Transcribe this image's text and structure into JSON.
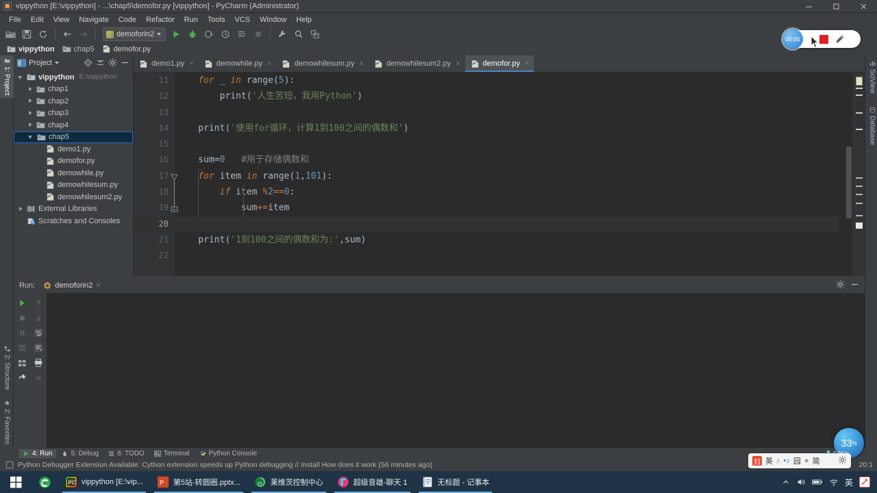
{
  "window": {
    "title": "vippython [E:\\vippython] - ...\\chap5\\demofor.py [vippython] - PyCharm (Administrator)",
    "app_icon": "pycharm-icon",
    "minimize": "–",
    "maximize": "□",
    "close": "✕"
  },
  "menubar": {
    "items": [
      {
        "label": "File"
      },
      {
        "label": "Edit"
      },
      {
        "label": "View"
      },
      {
        "label": "Navigate"
      },
      {
        "label": "Code"
      },
      {
        "label": "Refactor"
      },
      {
        "label": "Run"
      },
      {
        "label": "Tools"
      },
      {
        "label": "VCS"
      },
      {
        "label": "Window"
      },
      {
        "label": "Help"
      }
    ]
  },
  "toolbar": {
    "open_icon": "open-folder-icon",
    "save_icon": "save-icon",
    "sync_icon": "sync-icon",
    "back_icon": "arrow-back-icon",
    "forward_icon": "arrow-forward-icon",
    "run_config_name": "demoforin2",
    "run_icon": "run-icon",
    "debug_icon": "debug-icon",
    "coverage_icon": "run-coverage-icon",
    "profile_icon": "profile-icon",
    "rerun_icon": "run-with-console-icon",
    "stop_icon": "stop-icon",
    "settings_icon": "wrench-icon",
    "search_icon": "search-icon",
    "vcs_icon": "vcs-update-icon"
  },
  "breadcrumb": {
    "items": [
      {
        "label": "vippython",
        "icon": "folder-icon"
      },
      {
        "label": "chap5",
        "icon": "folder-icon"
      },
      {
        "label": "demofor.py",
        "icon": "python-file-icon"
      }
    ]
  },
  "left_stripe": {
    "items": [
      {
        "label": "1: Project",
        "icon": "project-icon",
        "selected": true
      },
      {
        "label": "2: Structure",
        "icon": "structure-icon",
        "selected": false
      },
      {
        "label": "2: Favorites",
        "icon": "star-icon",
        "selected": false
      }
    ]
  },
  "right_stripe": {
    "items": [
      {
        "label": "SciView",
        "icon": "sciview-icon"
      },
      {
        "label": "Database",
        "icon": "database-icon"
      }
    ]
  },
  "project_panel": {
    "title": "Project",
    "dropdown_icon": "chevron-down-icon",
    "actions": [
      {
        "name": "locate-icon"
      },
      {
        "name": "collapse-all-icon"
      },
      {
        "name": "gear-icon"
      },
      {
        "name": "hide-icon"
      }
    ],
    "tree": [
      {
        "label": "vippython",
        "path": "E:\\vippython",
        "depth": 0,
        "arrow": "open",
        "icon": "folder-icon",
        "bold": true,
        "selected": false
      },
      {
        "label": "chap1",
        "path": "",
        "depth": 1,
        "arrow": "closed",
        "icon": "folder-icon",
        "bold": false,
        "selected": false
      },
      {
        "label": "chap2",
        "path": "",
        "depth": 1,
        "arrow": "closed",
        "icon": "folder-icon",
        "bold": false,
        "selected": false
      },
      {
        "label": "chap3",
        "path": "",
        "depth": 1,
        "arrow": "closed",
        "icon": "folder-icon",
        "bold": false,
        "selected": false
      },
      {
        "label": "chap4",
        "path": "",
        "depth": 1,
        "arrow": "closed",
        "icon": "folder-icon",
        "bold": false,
        "selected": false
      },
      {
        "label": "chap5",
        "path": "",
        "depth": 1,
        "arrow": "open",
        "icon": "folder-icon",
        "bold": false,
        "selected": true
      },
      {
        "label": "demo1.py",
        "path": "",
        "depth": 2,
        "arrow": "none",
        "icon": "python-file-icon",
        "bold": false,
        "selected": false
      },
      {
        "label": "demofor.py",
        "path": "",
        "depth": 2,
        "arrow": "none",
        "icon": "python-file-icon",
        "bold": false,
        "selected": false
      },
      {
        "label": "demowhile.py",
        "path": "",
        "depth": 2,
        "arrow": "none",
        "icon": "python-file-icon",
        "bold": false,
        "selected": false
      },
      {
        "label": "demowhilesum.py",
        "path": "",
        "depth": 2,
        "arrow": "none",
        "icon": "python-file-icon",
        "bold": false,
        "selected": false
      },
      {
        "label": "demowhilesum2.py",
        "path": "",
        "depth": 2,
        "arrow": "none",
        "icon": "python-file-icon",
        "bold": false,
        "selected": false
      },
      {
        "label": "External Libraries",
        "path": "",
        "depth": 0,
        "arrow": "closed",
        "icon": "library-icon",
        "bold": false,
        "selected": false
      },
      {
        "label": "Scratches and Consoles",
        "path": "",
        "depth": 0,
        "arrow": "none",
        "icon": "scratches-icon",
        "bold": false,
        "selected": false
      }
    ]
  },
  "editor": {
    "tabs": [
      {
        "label": "demo1.py",
        "active": false,
        "close": "×"
      },
      {
        "label": "demowhile.py",
        "active": false,
        "close": "×"
      },
      {
        "label": "demowhilesum.py",
        "active": false,
        "close": "×"
      },
      {
        "label": "demowhilesum2.py",
        "active": false,
        "close": "×"
      },
      {
        "label": "demofor.py",
        "active": true,
        "close": "×"
      }
    ],
    "first_line_number": 11,
    "caret_line": 20,
    "lines": [
      {
        "n": 11,
        "tokens": [
          {
            "t": "    ",
            "c": "plain"
          },
          {
            "t": "for",
            "c": "kw"
          },
          {
            "t": " _ ",
            "c": "plain"
          },
          {
            "t": "in",
            "c": "kw"
          },
          {
            "t": " range",
            "c": "plain"
          },
          {
            "t": "(",
            "c": "op"
          },
          {
            "t": "5",
            "c": "num"
          },
          {
            "t": "):",
            "c": "op"
          }
        ]
      },
      {
        "n": 12,
        "tokens": [
          {
            "t": "        print",
            "c": "plain"
          },
          {
            "t": "(",
            "c": "op"
          },
          {
            "t": "'人生苦短，我用Python'",
            "c": "str"
          },
          {
            "t": ")",
            "c": "op"
          }
        ]
      },
      {
        "n": 13,
        "tokens": []
      },
      {
        "n": 14,
        "tokens": [
          {
            "t": "    print",
            "c": "plain"
          },
          {
            "t": "(",
            "c": "op"
          },
          {
            "t": "'使用for循环，计算1到100之间的偶数和'",
            "c": "str"
          },
          {
            "t": ")",
            "c": "op"
          }
        ]
      },
      {
        "n": 15,
        "tokens": []
      },
      {
        "n": 16,
        "tokens": [
          {
            "t": "    sum",
            "c": "plain"
          },
          {
            "t": "=",
            "c": "op"
          },
          {
            "t": "0",
            "c": "num"
          },
          {
            "t": "   ",
            "c": "plain"
          },
          {
            "t": "#用于存储偶数和",
            "c": "cmt"
          }
        ]
      },
      {
        "n": 17,
        "tokens": [
          {
            "t": "    ",
            "c": "plain"
          },
          {
            "t": "for",
            "c": "kw"
          },
          {
            "t": " item ",
            "c": "plain"
          },
          {
            "t": "in",
            "c": "kw"
          },
          {
            "t": " range",
            "c": "plain"
          },
          {
            "t": "(",
            "c": "op"
          },
          {
            "t": "1",
            "c": "num"
          },
          {
            "t": ",",
            "c": "op"
          },
          {
            "t": "101",
            "c": "num"
          },
          {
            "t": "):",
            "c": "op"
          }
        ]
      },
      {
        "n": 18,
        "tokens": [
          {
            "t": "        ",
            "c": "plain"
          },
          {
            "t": "if",
            "c": "kw"
          },
          {
            "t": " item ",
            "c": "plain"
          },
          {
            "t": "%",
            "c": "kw2"
          },
          {
            "t": "2",
            "c": "num"
          },
          {
            "t": "==",
            "c": "kw2"
          },
          {
            "t": "0",
            "c": "num"
          },
          {
            "t": ":",
            "c": "op"
          }
        ]
      },
      {
        "n": 19,
        "tokens": [
          {
            "t": "            sum",
            "c": "plain"
          },
          {
            "t": "+=",
            "c": "kw2"
          },
          {
            "t": "item",
            "c": "plain"
          }
        ]
      },
      {
        "n": 20,
        "tokens": []
      },
      {
        "n": 21,
        "tokens": [
          {
            "t": "    print",
            "c": "plain"
          },
          {
            "t": "(",
            "c": "op"
          },
          {
            "t": "'1到100之间的偶数和为:'",
            "c": "str"
          },
          {
            "t": ",",
            "c": "op"
          },
          {
            "t": "sum",
            "c": "plain"
          },
          {
            "t": ")",
            "c": "op"
          }
        ]
      },
      {
        "n": 22,
        "tokens": []
      }
    ]
  },
  "run_panel": {
    "label": "Run:",
    "tab_name": "demoforin2",
    "tab_close": "×",
    "gear_icon": "gear-icon",
    "hide_icon": "hide-icon",
    "console_output": "",
    "toolbar_icons": [
      "rerun-icon",
      "up-stacktrace-icon",
      "stop-icon",
      "down-stacktrace-icon",
      "pause-icon",
      "soft-wrap-icon",
      "print-to-file-icon",
      "scroll-to-end-icon",
      "clear-all-icon",
      "print-icon",
      "pin-icon",
      "close-icon"
    ]
  },
  "bottom_bar": {
    "items": [
      {
        "label": "4: Run",
        "icon": "run-icon",
        "selected": true
      },
      {
        "label": "5: Debug",
        "icon": "debug-icon",
        "selected": false
      },
      {
        "label": "6: TODO",
        "icon": "todo-icon",
        "selected": false
      },
      {
        "label": "Terminal",
        "icon": "terminal-icon",
        "selected": false
      },
      {
        "label": "Python Console",
        "icon": "python-console-icon",
        "selected": false
      }
    ]
  },
  "status_bar": {
    "icon": "notification-icon",
    "message": "Python Debugger Extension Available: Cython extension speeds up Python debugging // Install How does it work (56 minutes ago)",
    "clock": "20:1"
  },
  "taskbar": {
    "start_icon": "windows-start-icon",
    "apps": [
      {
        "label": "",
        "icon": "edge-browser-icon",
        "open": false
      },
      {
        "label": "vippython [E:\\vip...",
        "icon": "pycharm-icon",
        "open": true
      },
      {
        "label": "第5站-转圆圈.pptx...",
        "icon": "powerpoint-icon",
        "open": true
      },
      {
        "label": "莱维茨控制中心",
        "icon": "leiwei-icon",
        "open": true
      },
      {
        "label": "超级音雄-聊天 1",
        "icon": "chat-icon",
        "open": true
      },
      {
        "label": "无标题 - 记事本",
        "icon": "notepad-icon",
        "open": true
      }
    ],
    "tray": [
      {
        "name": "show-hidden-icons-icon",
        "glyph": "∧"
      },
      {
        "name": "volume-icon",
        "glyph": "🔊"
      },
      {
        "name": "battery-icon",
        "glyph": "▭"
      },
      {
        "name": "wifi-icon",
        "glyph": "◴"
      },
      {
        "name": "ime-chinese-icon",
        "glyph": "英"
      },
      {
        "name": "sogou-ime-icon",
        "glyph": "扫"
      }
    ]
  },
  "overlays": {
    "recorder": {
      "timer": "00:00",
      "pen_icon": "pen-icon",
      "stop_icon": "stop-record-icon",
      "cursor_icon": "mouse-cursor-icon"
    },
    "cpu_orb": {
      "value": "33",
      "unit": "%"
    },
    "network": {
      "speed": "0.9K/s",
      "up_icon": "upload-arrow-icon"
    },
    "ime_floating": {
      "logo": "扫",
      "items": [
        "英",
        "♪",
        "•♪",
        "园",
        "█",
        "简"
      ],
      "gear_icon": "gear-icon"
    }
  },
  "colors": {
    "ide_chrome": "#3c3f41",
    "editor_bg": "#2b2b2b",
    "gutter_bg": "#313335",
    "selection_blue": "#0d293e",
    "accent_blue": "#4a88c7",
    "keyword_orange": "#cc7832",
    "string_green": "#6a8759",
    "number_blue": "#6897bb",
    "comment_gray": "#808080",
    "taskbar_bg": "#1f3347"
  }
}
